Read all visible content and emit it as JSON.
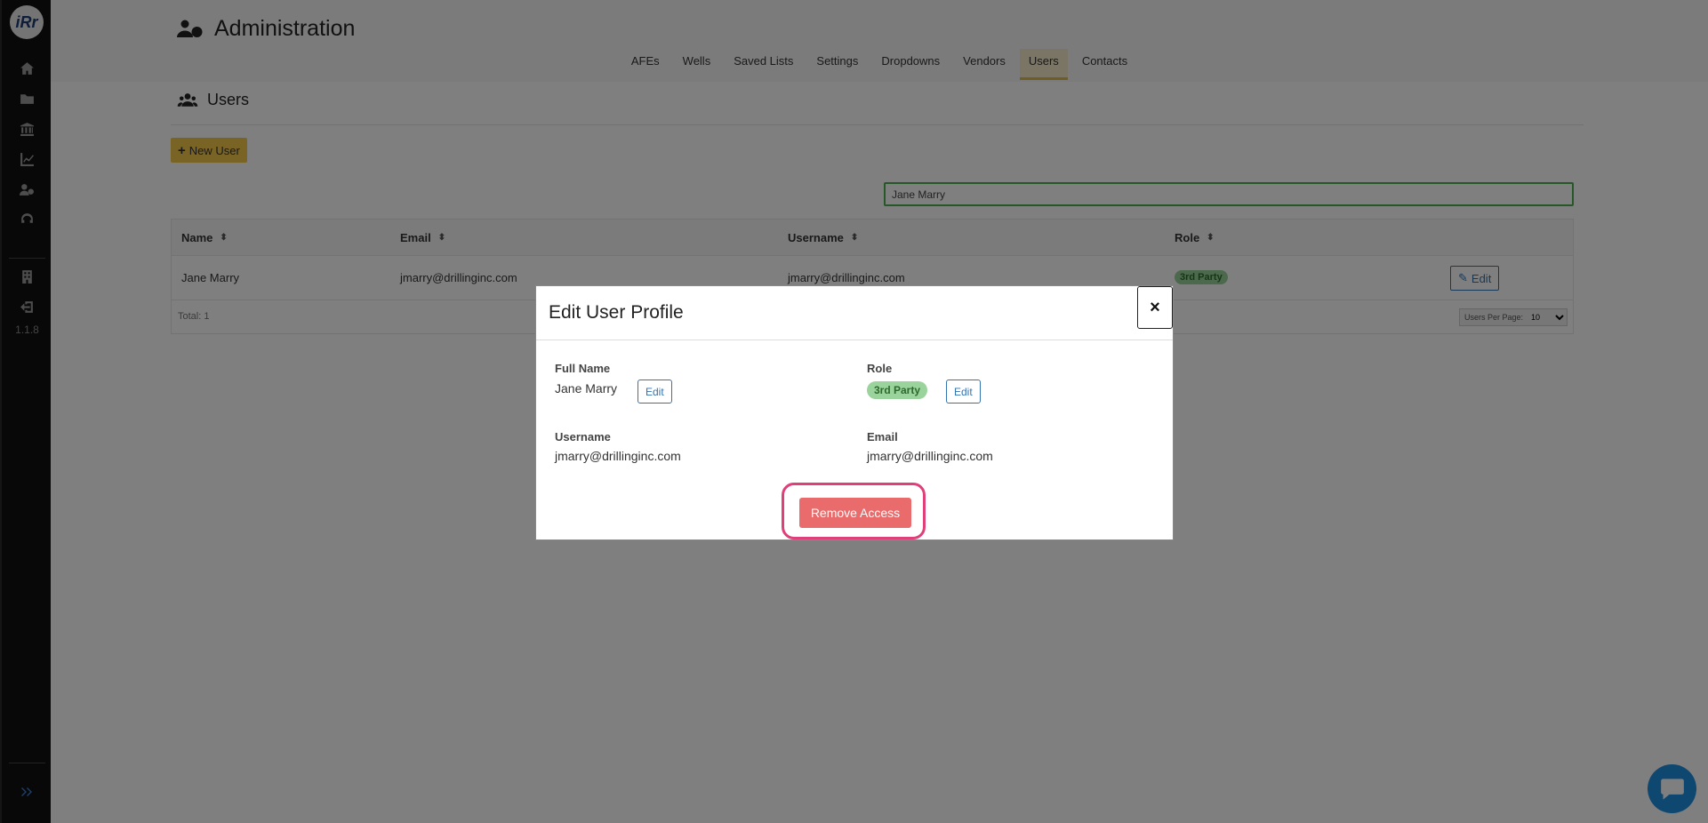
{
  "sidebar": {
    "logo_text": "iRr",
    "version": "1.1.8",
    "icons": [
      "home-icon",
      "folder-icon",
      "bank-icon",
      "chart-line-icon",
      "users-cog-icon",
      "headset-icon",
      "building-icon",
      "sign-out-icon",
      "expand-icon"
    ]
  },
  "header": {
    "title": "Administration",
    "tabs": [
      {
        "label": "AFEs"
      },
      {
        "label": "Wells"
      },
      {
        "label": "Saved Lists"
      },
      {
        "label": "Settings"
      },
      {
        "label": "Dropdowns"
      },
      {
        "label": "Vendors"
      },
      {
        "label": "Users",
        "active": true
      },
      {
        "label": "Contacts"
      }
    ]
  },
  "users_section": {
    "title": "Users",
    "new_user_label": "New User",
    "search_value": "Jane Marry",
    "columns": [
      "Name",
      "Email",
      "Username",
      "Role"
    ],
    "rows": [
      {
        "name": "Jane Marry",
        "email": "jmarry@drillinginc.com",
        "username": "jmarry@drillinginc.com",
        "role": "3rd Party",
        "edit_label": "Edit"
      }
    ],
    "total": "Total: 1",
    "per_page_label": "Users Per Page:",
    "per_page_value": "10"
  },
  "modal": {
    "title": "Edit User Profile",
    "close_label": "×",
    "full_name_label": "Full Name",
    "full_name": "Jane Marry",
    "role_label": "Role",
    "role": "3rd Party",
    "username_label": "Username",
    "username": "jmarry@drillinginc.com",
    "email_label": "Email",
    "email": "jmarry@drillinginc.com",
    "edit_label": "Edit",
    "remove_label": "Remove Access"
  },
  "colors": {
    "accent_yellow": "#f2c84c",
    "role_badge": "#9ad39b",
    "remove_button": "#e96b6b",
    "highlight_ring": "#e0407a",
    "search_border": "#4caf50",
    "chat_button": "#1c8ee0"
  }
}
